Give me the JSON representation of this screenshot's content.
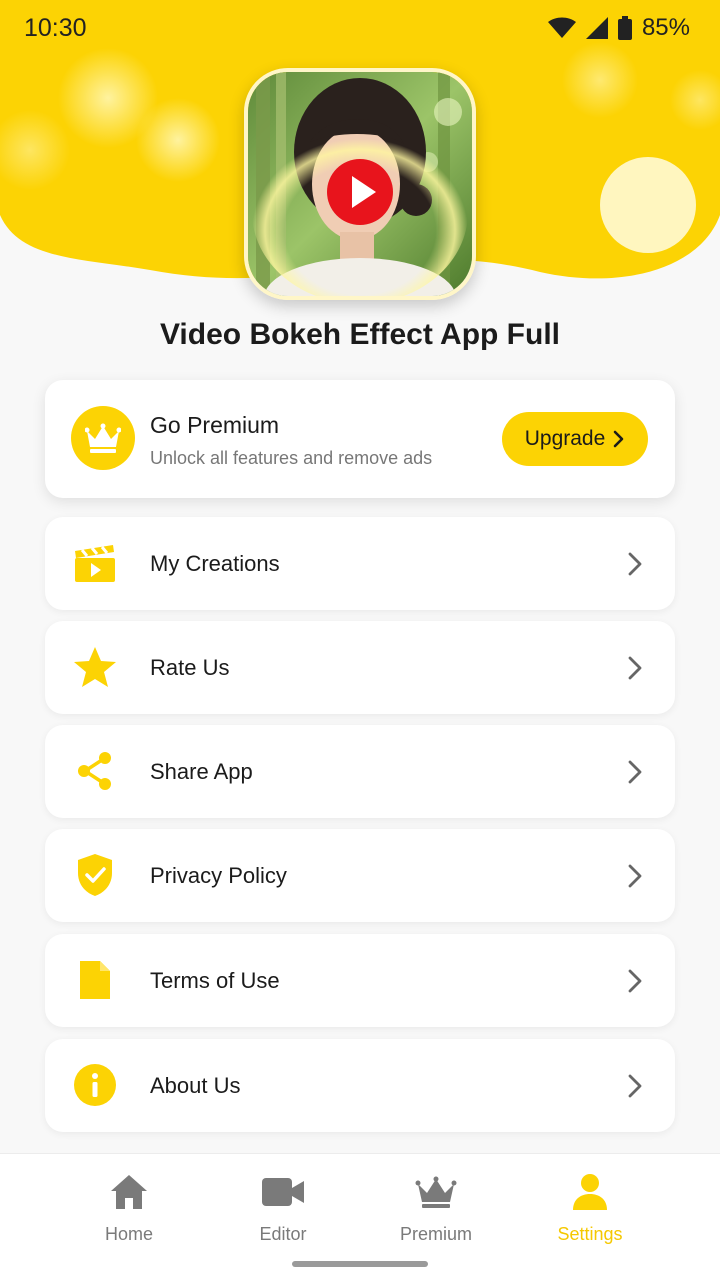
{
  "status_bar": {
    "time": "10:30",
    "battery": "85%"
  },
  "app": {
    "title": "Video Bokeh Effect App Full"
  },
  "premium": {
    "title": "Go Premium",
    "subtitle": "Unlock all features and remove ads",
    "button_label": "Upgrade"
  },
  "menu": {
    "items": [
      {
        "label": "My Creations",
        "icon": "clapperboard-icon"
      },
      {
        "label": "Rate Us",
        "icon": "star-icon"
      },
      {
        "label": "Share App",
        "icon": "share-icon"
      },
      {
        "label": "Privacy Policy",
        "icon": "shield-check-icon"
      },
      {
        "label": "Terms of Use",
        "icon": "document-icon"
      },
      {
        "label": "About Us",
        "icon": "info-icon"
      }
    ]
  },
  "bottom_nav": {
    "items": [
      {
        "label": "Home",
        "icon": "home-icon"
      },
      {
        "label": "Editor",
        "icon": "video-camera-icon"
      },
      {
        "label": "Premium",
        "icon": "crown-icon"
      },
      {
        "label": "Settings",
        "icon": "person-icon"
      }
    ],
    "active": "Settings"
  },
  "colors": {
    "accent": "#fcd304",
    "accent_text_active": "#f5c800",
    "play_button": "#e8141c",
    "background": "#f8f8f8"
  }
}
